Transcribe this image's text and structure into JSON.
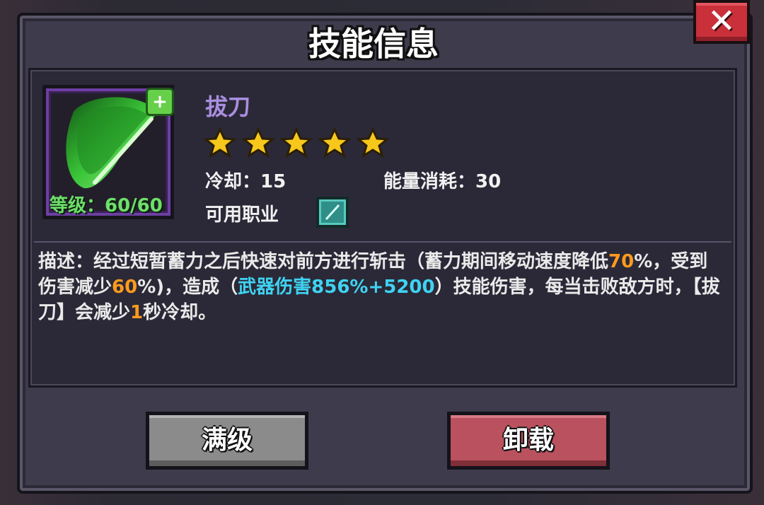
{
  "dialog": {
    "title": "技能信息",
    "close_label": "✕"
  },
  "skill": {
    "name": "拔刀",
    "stars": 5,
    "level_text": "等级：60/60",
    "cooldown_text": "冷却：15",
    "energy_text": "能量消耗：30",
    "job_label": "可用职业",
    "icon": "green-slash-icon",
    "job_icon": "sword-class-icon"
  },
  "description": {
    "p1": "描述：经过短暂蓄力之后快速对前方进行斩击（蓄力期间移动速度降低",
    "v1": "70",
    "p2": "%，受到伤害减少",
    "v2": "60",
    "p3": "%)，造成（",
    "v3": "武器伤害856%+5200",
    "p4": "）技能伤害，每当击败敌方时，【拔刀】会减少",
    "v4": "1",
    "p5": "秒冷却。"
  },
  "buttons": {
    "max": "满级",
    "unload": "卸载"
  },
  "colors": {
    "accent_orange": "#ff9a1e",
    "accent_cyan": "#3fd3f2",
    "name_purple": "#a98ee0",
    "level_green": "#6de06a"
  }
}
